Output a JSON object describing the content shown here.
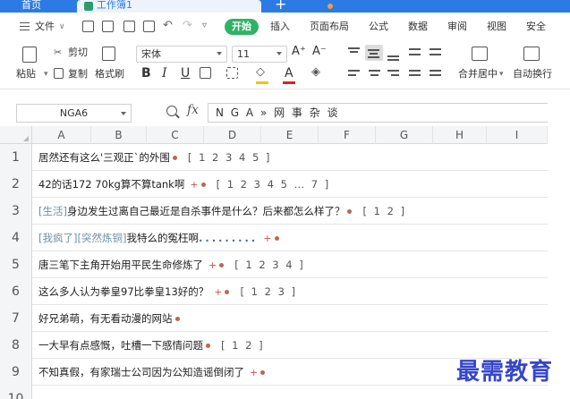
{
  "titlebar": {
    "home_tab": "首页",
    "doc_tab": "工作簿1",
    "new_tab": "+"
  },
  "menu": {
    "file": "文件",
    "file_caret": "∨",
    "start": "开始",
    "items": [
      "插入",
      "页面布局",
      "公式",
      "数据",
      "审阅",
      "视图",
      "安全"
    ]
  },
  "ribbon": {
    "paste": "粘贴",
    "cut": "剪切",
    "copy": "复制",
    "format_painter": "格式刷",
    "font_name": "宋体",
    "font_size": "11",
    "grow": "A⁺",
    "shrink": "A⁻",
    "bold": "B",
    "italic": "I",
    "underline": "U",
    "font_color": "A",
    "merge_center": "合并居中",
    "auto_wrap": "自动换行"
  },
  "formula_bar": {
    "name_box": "NGA6",
    "fx": "fx",
    "value": "N G A » 网 事 杂 谈"
  },
  "columns": [
    "A",
    "B",
    "C",
    "D",
    "E",
    "F",
    "G",
    "H",
    "I"
  ],
  "rows": [
    {
      "num": "1",
      "tag": "",
      "text": "居然还有这么'三观正`的外围",
      "plus": false,
      "pages": "[ 1 2 3 4 5 ]"
    },
    {
      "num": "2",
      "tag": "",
      "text": "42的话172 70kg算不算tank啊",
      "plus": true,
      "pages": "[ 1 2 3 4 5 … 7 ]"
    },
    {
      "num": "3",
      "tag": "[生活]",
      "text": "身边发生过离自己最近是自杀事件是什么？后来都怎么样了？",
      "plus": false,
      "pages": "[ 1 2 ]"
    },
    {
      "num": "4",
      "tag": "[我疯了][突然炼铜]",
      "text": "我特么的冤枉啊",
      "plus": true,
      "pages": "",
      "trail_dots": "........."
    },
    {
      "num": "5",
      "tag": "",
      "text": "唐三笔下主角开始用平民生命修炼了",
      "plus": true,
      "pages": "[ 1 2 3 4 ]"
    },
    {
      "num": "6",
      "tag": "",
      "text": "这么多人认为拳皇97比拳皇13好的？",
      "plus": true,
      "pages": "[ 1 2 3 ]"
    },
    {
      "num": "7",
      "tag": "",
      "text": "好兄弟萌，有无看动漫的网站",
      "plus": false,
      "pages": ""
    },
    {
      "num": "8",
      "tag": "",
      "text": "一大早有点感慨，吐槽一下感情问题",
      "plus": false,
      "pages": "[ 1 2 ]"
    },
    {
      "num": "9",
      "tag": "",
      "text": "不知真假，有家瑞士公司因为公知造谣倒闭了",
      "plus": true,
      "pages": ""
    }
  ],
  "row10_num": "10",
  "plus_mark": "+",
  "watermark": "最需教育"
}
